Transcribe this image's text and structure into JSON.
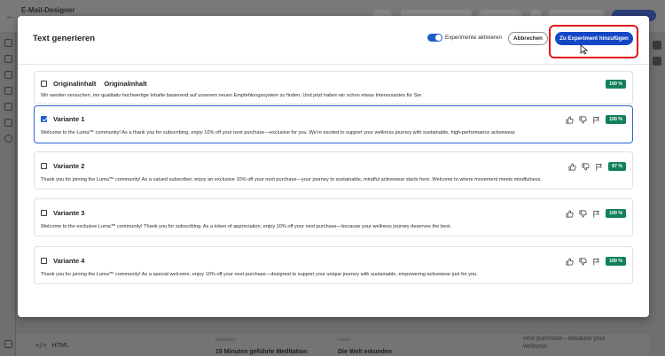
{
  "app": {
    "title": "E-Mail-Designer",
    "bottom_html_label": "HTML",
    "bottom_cards": [
      {
        "label": "Meditation",
        "title": "15 Minuten geführte Meditation"
      },
      {
        "label": "Lesen",
        "title": "Die Welt erkunden"
      }
    ],
    "bottom_right_text": "next purchase—because your wellness"
  },
  "modal": {
    "title": "Text generieren",
    "toggle_label": "Experimente aktivieren",
    "toggle_on": true,
    "cancel_label": "Abbrechen",
    "primary_label": "Zu Experiment hinzufügen",
    "accent_color": "#1447c6",
    "highlight_color": "#e3141b"
  },
  "cards": [
    {
      "title": "Originalinhalt",
      "subtitle": "Originalinhalt",
      "checked": false,
      "selected": false,
      "show_feedback": false,
      "score": "100 %",
      "text": "Wir werden versuchen, mir qualitativ hochwertige Inhalte basierend auf unserem neuen Empfehlungssystem zu finden. Und jetzt haben wir schon etwas Interessantes für Sie:"
    },
    {
      "title": "Variante 1",
      "subtitle": "",
      "checked": true,
      "selected": true,
      "show_feedback": true,
      "score": "100 %",
      "text": "Welcome to the Luma™ community! As a thank you for subscribing, enjoy 10% off your next purchase—exclusive for you. We're excited to support your wellness journey with sustainable, high-performance activewear."
    },
    {
      "title": "Variante 2",
      "subtitle": "",
      "checked": false,
      "selected": false,
      "show_feedback": true,
      "score": "87 %",
      "text": "Thank you for joining the Luma™ community! As a valued subscriber, enjoy an exclusive 10% off your next purchase—your journey to sustainable, mindful activewear starts here. Welcome to where movement meets mindfulness."
    },
    {
      "title": "Variante 3",
      "subtitle": "",
      "checked": false,
      "selected": false,
      "show_feedback": true,
      "score": "100 %",
      "text": "Welcome to the exclusive Luma™ community! Thank you for subscribing. As a token of appreciation, enjoy 10% off your next purchase—because your wellness journey deserves the best."
    },
    {
      "title": "Variante 4",
      "subtitle": "",
      "checked": false,
      "selected": false,
      "show_feedback": true,
      "score": "100 %",
      "text": "Thank you for joining the Luma™ community! As a special welcome, enjoy 10% off your next purchase—designed to support your unique journey with sustainable, empowering activewear just for you."
    }
  ]
}
